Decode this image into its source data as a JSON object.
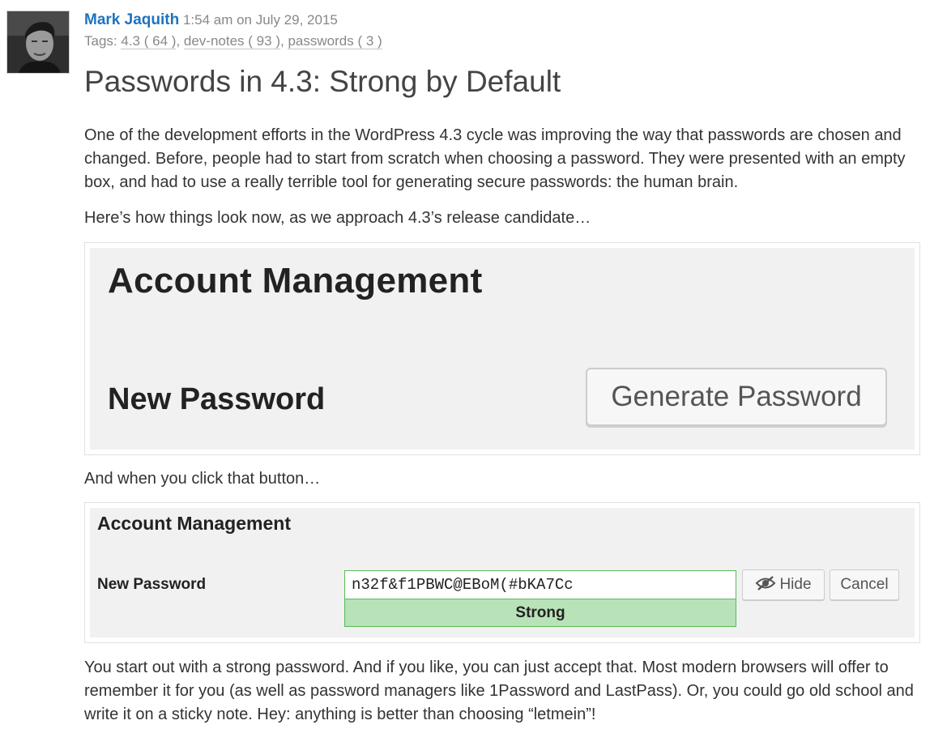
{
  "post": {
    "author": "Mark Jaquith",
    "timestamp": "1:54 am on July 29, 2015",
    "tags_label": "Tags:",
    "tags": [
      {
        "name": "4.3",
        "count": "( 64 )"
      },
      {
        "name": "dev-notes",
        "count": "( 93 )"
      },
      {
        "name": "passwords",
        "count": "( 3 )"
      }
    ],
    "title": "Passwords in 4.3: Strong by Default",
    "paragraph1": "One of the development efforts in the WordPress 4.3 cycle was improving the way that passwords are chosen and changed. Before, people had to start from scratch when choosing a password. They were presented with an empty box, and had to use a really terrible tool for generating secure passwords: the human brain.",
    "paragraph2": "Here’s how things look now, as we approach 4.3’s release candidate…",
    "paragraph3": "And when you click that button…",
    "paragraph4": "You start out with a strong password. And if you like, you can just accept that. Most modern browsers will offer to remember it for you (as well as password managers like 1Password and LastPass). Or, you could go old school and write it on a sticky note. Hey: anything is better than choosing “letmein”!"
  },
  "screenshot1": {
    "heading": "Account Management",
    "label": "New Password",
    "button": "Generate Password"
  },
  "screenshot2": {
    "heading": "Account Management",
    "label": "New Password",
    "password_value": "n32f&f1PBWC@EBoM(#bKA7Cc",
    "strength": "Strong",
    "hide_button": "Hide",
    "cancel_button": "Cancel"
  },
  "colors": {
    "author_link": "#1e73be",
    "strength_bg": "#b8e2b8",
    "strength_border": "#5cb85c"
  }
}
